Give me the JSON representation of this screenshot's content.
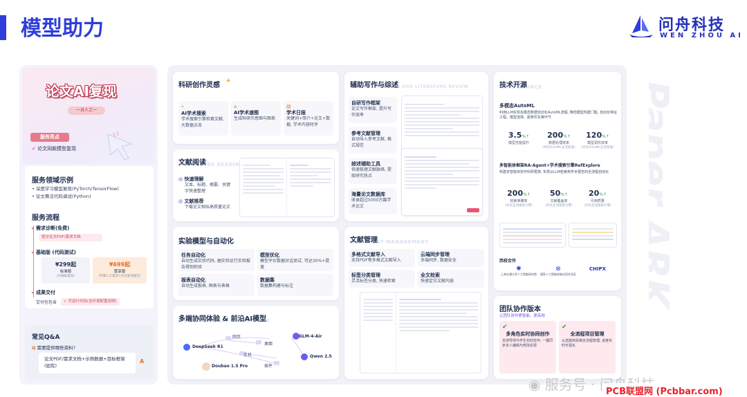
{
  "header": {
    "title": "模型助力",
    "logo_name": "问舟科技",
    "logo_sub": "WEN ZHOU AI",
    "brand_color": "#2f3ed8"
  },
  "left": {
    "badge": "论文AI复现",
    "badge_sub": "一对人工一",
    "highlight_tag": "服务亮点",
    "highlight_item": "论文同款模型复现",
    "domain_title": "服务领域示例",
    "domain_items": [
      "深度学习模型复现(PyTorch/TensorFlow)",
      "论文算法代码调试(Python)"
    ],
    "process_title": "服务流程",
    "step1": "需求诊断(免费)",
    "step1_sub": "提交论文PDF/需求文档",
    "step2": "基础版 (代码测试)",
    "price1": "¥299起",
    "price1_name": "标准版",
    "price1_note": "(AI辅助复现)",
    "price2": "¥699起",
    "price2_name": "尊享版",
    "price2_note": "(专属人工复现+论文复现报告)",
    "step3": "成果交付",
    "deliver": "交付包包含",
    "deliver_item": "可运行代码(含环境配置说明)",
    "qa_title": "常见Q&A",
    "qa_q": "需要提供哪些资料?",
    "qa_a": "论文PDF/需求文档+示例数据+目标框架(如有)",
    "qa_a_icon": "A"
  },
  "inspiration": {
    "title": "科研创作灵感",
    "items": [
      {
        "title": "AI学术搜索",
        "desc": "学术搜索引擎检索文献, 大数据点击"
      },
      {
        "title": "AI学术速图",
        "desc": "生成科研示意图与图表"
      },
      {
        "title": "学术日报",
        "desc": "关键词+简介+论文+数据, 学术内容时评"
      }
    ]
  },
  "reading": {
    "title": "文献阅读",
    "ghost": "LITERATURE READING",
    "f1": "快速理解",
    "f1_desc": "文本、标题、摘要、关键字快速整理",
    "f2": "文献推荐",
    "f2_desc": "下载论文相似高质量论文"
  },
  "experiment": {
    "title": "实验模型与自动化",
    "ghost": "AUTOMATION",
    "items": [
      {
        "title": "任务自动化",
        "desc": "自动生成实验代码, 据实验运行实验报告得到检验"
      },
      {
        "title": "模型优化",
        "desc": "模型评价数据对话测试, 可达30%+提速"
      },
      {
        "title": "报表自动化",
        "desc": "自动生成报表, 图表与表格"
      },
      {
        "title": "数据集",
        "desc": "数据集构建与标注"
      }
    ]
  },
  "multi": {
    "title": "多端协同体验 & 前沿AI模型",
    "ghost": "MULTI-TERMINAL & MULTI-LLM",
    "nodes": [
      "DeepSeek R1",
      "GLM-4-Air",
      "Qwen 2.5",
      "Doubao 1.5 Pro",
      "网页",
      "桌面",
      "手机",
      "插件"
    ]
  },
  "writing": {
    "title": "辅助写作与综述",
    "ghost": "ASSISTED WRITING AND LITERATURE REVIEW",
    "items": [
      {
        "title": "自研写作框架",
        "desc": "论文写作框架, 提升写作效率"
      },
      {
        "title": "参考文献管理",
        "desc": "自动导入参考文献, 格式规范"
      },
      {
        "title": "综述辅助工具",
        "desc": "快速梳理文献脉络, 提取研究热点"
      },
      {
        "title": "海量论文数据库",
        "desc": "收录超过5000万篇学术论文"
      }
    ]
  },
  "docmgmt": {
    "title": "文献管理",
    "ghost": "DOCUMENT MANAGEMENT",
    "items": [
      {
        "title": "多格式文献导入",
        "desc": "支持PDF等多格式文献导入"
      },
      {
        "title": "云端同步管理",
        "desc": "多端同步, 数据安全"
      },
      {
        "title": "标签分类管理",
        "desc": "灵活标签分类, 快速检索"
      },
      {
        "title": "全文检索",
        "desc": "快速定位文献内容"
      }
    ]
  },
  "tech": {
    "title": "技术开源",
    "ghost": "OPEN SOURCE",
    "p1_title": "多模态AutoML",
    "p1_desc": "利用LLM实现多模态数据自动化AutoML流程, 降低模型构建门槛, 自动化特征工程、模型选择、超参优化等环节",
    "p1_stats": [
      {
        "n": "3.5",
        "arrow": "%↑",
        "l": "模型性能提升",
        "s": ""
      },
      {
        "n": "200",
        "arrow": "%↑",
        "l": "数据处理效率",
        "s": "(对比AutoML主流基准)"
      },
      {
        "n": "120",
        "arrow": "%↑",
        "l": "模型调优效率",
        "s": "(对比AutoML主流基准)"
      }
    ],
    "p2_title": "多智能体框架RA-Agent+学术搜索引擎RefExplore",
    "p2_desc": "构建多智能体协作科研框架, 实现从LLM检索到学术报告的全流程自动化",
    "p2_stats": [
      {
        "n": "200",
        "arrow": "%↑",
        "l": "检索准确率",
        "s": "(对比主流搜索引擎)"
      },
      {
        "n": "50",
        "arrow": "%↑",
        "l": "文献覆盖率",
        "s": "(对比主流搜索引擎)"
      },
      {
        "n": "20",
        "arrow": "%↑",
        "l": "引用质量",
        "s": "(对比主流搜索引擎)"
      }
    ],
    "partners_title": "西校合作",
    "partners": [
      "上海交通大学人工智能研究院",
      "国家人工智能创新应用先导区",
      "CHIPX"
    ]
  },
  "team": {
    "title": "团队协作版本",
    "subtitle": "让团队协作更智能、更高效",
    "items": [
      {
        "title": "多角色实时协同创作",
        "desc": "支持导师与学生实时协作, 一键同步多人编辑与修改反馈"
      },
      {
        "title": "全流程项目管理",
        "desc": "从选题到投稿全流程管理, 进度实时可视化"
      }
    ]
  },
  "side": {
    "text": "Paper ARK"
  },
  "watermark": {
    "text": "服务号 · 问舟科技",
    "source": "PCB联盟网 (Pcbbar.com)"
  }
}
